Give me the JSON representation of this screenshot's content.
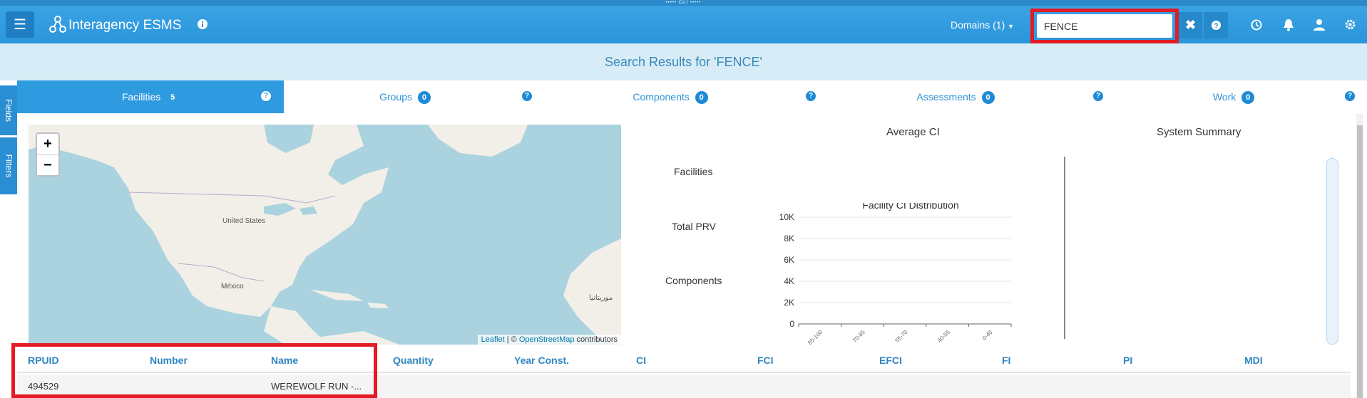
{
  "banner": {
    "text": "••••• CUI •••••"
  },
  "navbar": {
    "app_title": "Interagency ESMS",
    "domains_label": "Domains (1)",
    "search_value": "FENCE",
    "icons": [
      "menu-icon",
      "network-logo-icon",
      "info-icon",
      "close-icon",
      "help-icon",
      "history-icon",
      "bell-icon",
      "user-icon",
      "settings-icon"
    ]
  },
  "results": {
    "title": "Search Results for 'FENCE'"
  },
  "tabs": [
    {
      "label": "Facilities",
      "count": "5"
    },
    {
      "label": "Groups",
      "count": "0"
    },
    {
      "label": "Components",
      "count": "0"
    },
    {
      "label": "Assessments",
      "count": "0"
    },
    {
      "label": "Work",
      "count": "0"
    }
  ],
  "side_tabs": {
    "fields": "Fields",
    "filters": "Filters"
  },
  "map": {
    "zoom_in": "+",
    "zoom_out": "−",
    "labels": {
      "us": "United States",
      "mexico": "México",
      "mauritania": "موريتانيا"
    },
    "attribution": {
      "leaflet": "Leaflet",
      "sep": " | © ",
      "osm": "OpenStreetMap",
      "suffix": " contributors"
    }
  },
  "summary": {
    "average_ci_title": "Average CI",
    "system_summary_title": "System Summary",
    "row_labels": {
      "facilities": "Facilities",
      "total_prv": "Total PRV",
      "components": "Components"
    }
  },
  "chart_data": {
    "type": "bar",
    "title": "Facility CI Distribution",
    "categories": [
      "85-100",
      "70-85",
      "55-70",
      "40-55",
      "0-40"
    ],
    "values": [
      0,
      0,
      0,
      0,
      0
    ],
    "ylim": [
      0,
      10000
    ],
    "yticks": [
      "0",
      "2K",
      "4K",
      "6K",
      "8K",
      "10K"
    ],
    "xlabel": "",
    "ylabel": "",
    "grid": true
  },
  "grid": {
    "columns": [
      "RPUID",
      "Number",
      "Name",
      "Quantity",
      "Year Const.",
      "CI",
      "FCI",
      "EFCI",
      "FI",
      "PI",
      "MDI"
    ],
    "rows": [
      {
        "rpuid": "494529",
        "number": "",
        "name": "WEREWOLF RUN -..."
      }
    ]
  },
  "colors": {
    "navbar": "#2b95db",
    "highlight": "#e21b24",
    "link": "#2e86c1"
  }
}
